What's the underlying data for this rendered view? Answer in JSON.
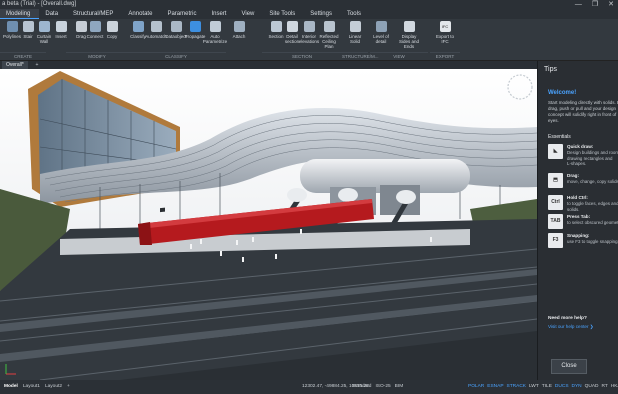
{
  "window": {
    "title": "a beta (Trial) - [Overall.dwg]",
    "controls": [
      "—",
      "❐",
      "✕"
    ]
  },
  "menu": {
    "tabs": [
      {
        "label": "Modeling",
        "active": true
      },
      {
        "label": "Data"
      },
      {
        "label": "Structural/MEP"
      },
      {
        "label": "Annotate"
      },
      {
        "label": "Parametric"
      },
      {
        "label": "Insert"
      },
      {
        "label": "View"
      },
      {
        "label": "Site Tools"
      },
      {
        "label": "Settings"
      },
      {
        "label": "Tools"
      }
    ]
  },
  "ribbon": {
    "items": [
      {
        "label": "Polylines",
        "icon": "polylines-icon",
        "color": "#6f8fb0"
      },
      {
        "label": "Stair",
        "icon": "stair-icon",
        "color": "#b7c4d1"
      },
      {
        "label": "Curtain Wall",
        "icon": "curtain-wall-icon",
        "color": "#9db6cf"
      },
      {
        "label": "Insert",
        "icon": "insert-icon",
        "color": "#c9d3dd"
      },
      {
        "label": "Drag",
        "icon": "drag-icon",
        "color": "#c7ced6"
      },
      {
        "label": "Connect",
        "icon": "connect-icon",
        "color": "#8fa7bf"
      },
      {
        "label": "Copy",
        "icon": "copy-icon",
        "color": "#cbd3db"
      },
      {
        "label": "Classify",
        "icon": "classify-icon",
        "color": "#7fa4c9"
      },
      {
        "label": "Automatch",
        "icon": "automatch-icon",
        "color": "#b5c1cd"
      },
      {
        "label": "Dataobject",
        "icon": "dataobject-icon",
        "color": "#aab8c6"
      },
      {
        "label": "Propagate",
        "icon": "propagate-icon",
        "color": "#3d8fe0"
      },
      {
        "label": "Auto Parametrize",
        "icon": "auto-parametrize-icon",
        "color": "#c1ccd7"
      },
      {
        "label": "Attach",
        "icon": "attach-icon",
        "color": "#9fb0c1"
      },
      {
        "label": "Section",
        "icon": "section-icon",
        "color": "#bcc8d4"
      },
      {
        "label": "Detail section",
        "icon": "detail-section-icon",
        "color": "#cfd7df"
      },
      {
        "label": "Interior elevations",
        "icon": "interior-elevations-icon",
        "color": "#a9b7c5"
      },
      {
        "label": "Reflected Ceiling Plan",
        "icon": "reflected-ceiling-icon",
        "color": "#b9c4cf"
      },
      {
        "label": "Linear Solid",
        "icon": "linear-solid-icon",
        "color": "#c4cdd6"
      },
      {
        "label": "Level of detail",
        "icon": "level-of-detail-icon",
        "color": "#8ea2b6"
      },
      {
        "label": "Display Sides and Ends",
        "icon": "display-sides-icon",
        "color": "#d2d9e0"
      },
      {
        "label": "Export to IFC",
        "icon": "export-ifc-icon",
        "color": "#e2e6ea",
        "badge": "IFC"
      }
    ],
    "groups": [
      "CREATE",
      "MODIFY",
      "CLASSIFY",
      "SECTION",
      "STRUCTURE/M...",
      "VIEW",
      "EXPORT"
    ]
  },
  "document": {
    "tab_label": "Overall*",
    "add_label": "+"
  },
  "tips": {
    "title": "Tips",
    "welcome": "Welcome!",
    "intro": "Start modeling directly with solids. B\ndrag, push or pull and your design\nconcept will solidify right in front of\neyes.",
    "essentials_label": "Essentials",
    "items": [
      {
        "title": "Quick draw:",
        "desc": "Design buildings and room\ndrawing rectangles and\nL-shapes.",
        "icon": "quick-draw-icon",
        "glyph": "◣"
      },
      {
        "title": "Drag:",
        "desc": "move, change, copy solids.",
        "icon": "drag-tip-icon",
        "glyph": "⬒"
      },
      {
        "title": "Hold Ctrl:",
        "desc": "to toggle faces, edges and\nsolids.",
        "icon": "ctrl-key-icon",
        "glyph": "Ctrl"
      },
      {
        "title": "Press Tab:",
        "desc": "to select obscured geometr",
        "icon": "tab-key-icon",
        "glyph": "TAB"
      },
      {
        "title": "Snapping:",
        "desc": "use F3 to toggle snapping.",
        "icon": "f3-key-icon",
        "glyph": "F3"
      }
    ],
    "help_label": "Need more help?",
    "help_link": "Visit our help center ❯",
    "close_label": "Close"
  },
  "status": {
    "layout_tabs": [
      {
        "label": "Model",
        "active": true
      },
      {
        "label": "Layout1"
      },
      {
        "label": "Layout2"
      },
      {
        "label": "+"
      }
    ],
    "coords": "12302.47, -49884.25, 10875.25",
    "items": [
      {
        "label": "Standard"
      },
      {
        "label": "ISO-25"
      },
      {
        "label": "BIM"
      }
    ],
    "toggles": [
      {
        "label": "POLAR",
        "on": true
      },
      {
        "label": "ESNAP",
        "on": true
      },
      {
        "label": "STRACK",
        "on": true
      },
      {
        "label": "LWT"
      },
      {
        "label": "TILE"
      },
      {
        "label": "DUCS",
        "on": true
      },
      {
        "label": "DYN",
        "on": true
      },
      {
        "label": "QUAD"
      },
      {
        "label": "RT"
      },
      {
        "label": "HKA"
      }
    ]
  }
}
